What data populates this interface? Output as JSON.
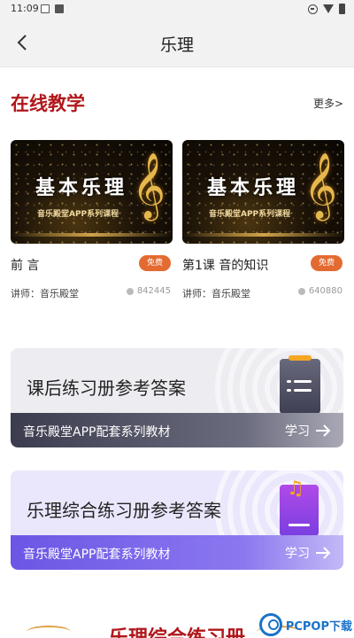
{
  "status_bar": {
    "time": "11:09"
  },
  "nav": {
    "title": "乐理"
  },
  "section": {
    "title": "在线教学",
    "more": "更多>"
  },
  "courses": [
    {
      "cover_title": "基本乐理",
      "cover_subtitle": "音乐殿堂APP系列课程",
      "name": "前 言",
      "badge": "免费",
      "teacher": "讲师：音乐殿堂",
      "views": "842445"
    },
    {
      "cover_title": "基本乐理",
      "cover_subtitle": "音乐殿堂APP系列课程",
      "name": "第1课  音的知识",
      "badge": "免费",
      "teacher": "讲师：音乐殿堂",
      "views": "640880"
    }
  ],
  "banners": [
    {
      "title": "课后练习册参考答案",
      "subtitle": "音乐殿堂APP配套系列教材",
      "action": "学习"
    },
    {
      "title": "乐理综合练习册参考答案",
      "subtitle": "音乐殿堂APP配套系列教材",
      "action": "学习"
    }
  ],
  "bottom_section": {
    "title": "乐理综合练习册"
  },
  "watermark": {
    "text": "PCPOP下载"
  },
  "colors": {
    "accent_red": "#b0171b",
    "badge_orange": "#e36b32",
    "purple": "#6b56e5"
  }
}
